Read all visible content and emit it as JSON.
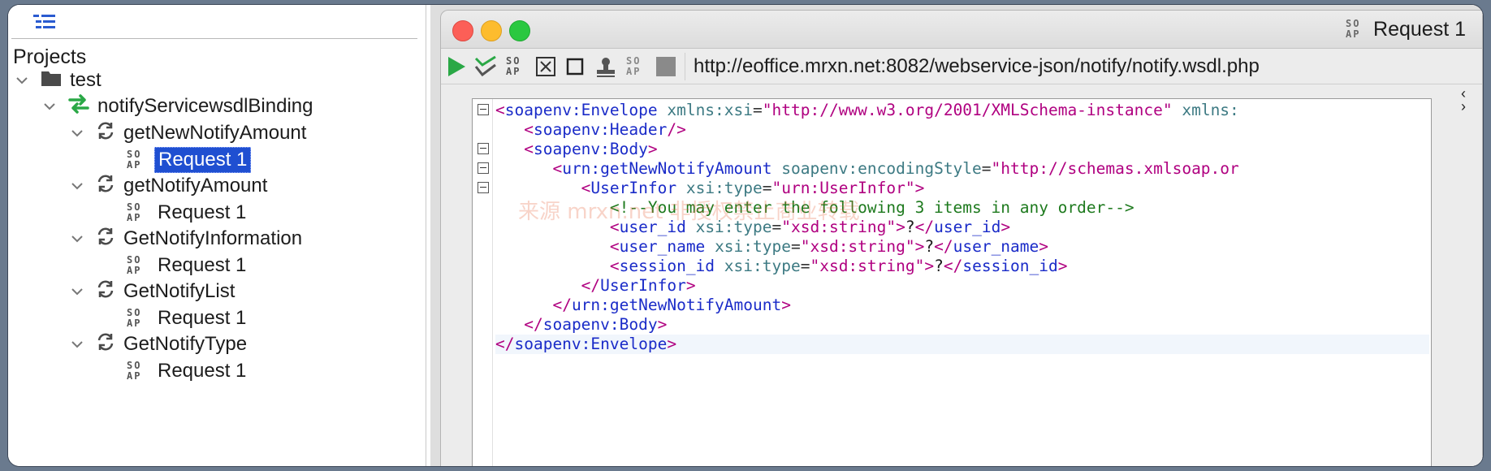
{
  "tree": {
    "projects_label": "Projects",
    "project": "test",
    "binding": "notifyServicewsdlBinding",
    "operations": [
      {
        "name": "getNewNotifyAmount",
        "request": "Request 1"
      },
      {
        "name": "getNotifyAmount",
        "request": "Request 1"
      },
      {
        "name": "GetNotifyInformation",
        "request": "Request 1"
      },
      {
        "name": "GetNotifyList",
        "request": "Request 1"
      },
      {
        "name": "GetNotifyType",
        "request": "Request 1"
      }
    ],
    "soap_badge_top": "SO",
    "soap_badge_bottom": "AP"
  },
  "window": {
    "title": "Request 1",
    "endpoint": "http://eoffice.mrxn.net:8082/webservice-json/notify/notify.wsdl.php"
  },
  "editor": {
    "watermark": "来源 mrxn.net 非授权禁止商业转载",
    "lines": {
      "l1_tag": "soapenv:Envelope",
      "l1_attr1": "xmlns:xsi",
      "l1_val1": "\"http://www.w3.org/2001/XMLSchema-instance\"",
      "l1_attr2": "xmlns:",
      "l2_tag": "soapenv:Header",
      "l3_tag": "soapenv:Body",
      "l4_tag": "urn:getNewNotifyAmount",
      "l4_attr": "soapenv:encodingStyle",
      "l4_val": "\"http://schemas.xmlsoap.or",
      "l5_tag": "UserInfor",
      "l5_attr": "xsi:type",
      "l5_val": "\"urn:UserInfor\"",
      "l6_comment": "<!--You may enter the following 3 items in any order-->",
      "l7_tag": "user_id",
      "l7_attr": "xsi:type",
      "l7_val": "\"xsd:string\"",
      "l7_text": "?",
      "l8_tag": "user_name",
      "l8_attr": "xsi:type",
      "l8_val": "\"xsd:string\"",
      "l8_text": "?",
      "l9_tag": "session_id",
      "l9_attr": "xsi:type",
      "l9_val": "\"xsd:string\"",
      "l9_text": "?",
      "l10_tag": "UserInfor",
      "l11_tag": "urn:getNewNotifyAmount",
      "l12_tag": "soapenv:Body",
      "l13_tag": "soapenv:Envelope"
    }
  },
  "colors": {
    "selection": "#1f4fd1",
    "xml_tag": "#1a2bc8",
    "xml_attr": "#3d7a83",
    "xml_value": "#b00080",
    "xml_comment": "#1e7a1e"
  },
  "icons": {
    "tree_toolbar": "tree-view-icon",
    "project": "folder-icon",
    "binding": "interface-arrows-icon",
    "operation": "refresh-cycle-icon",
    "request": "soap-request-icon"
  }
}
